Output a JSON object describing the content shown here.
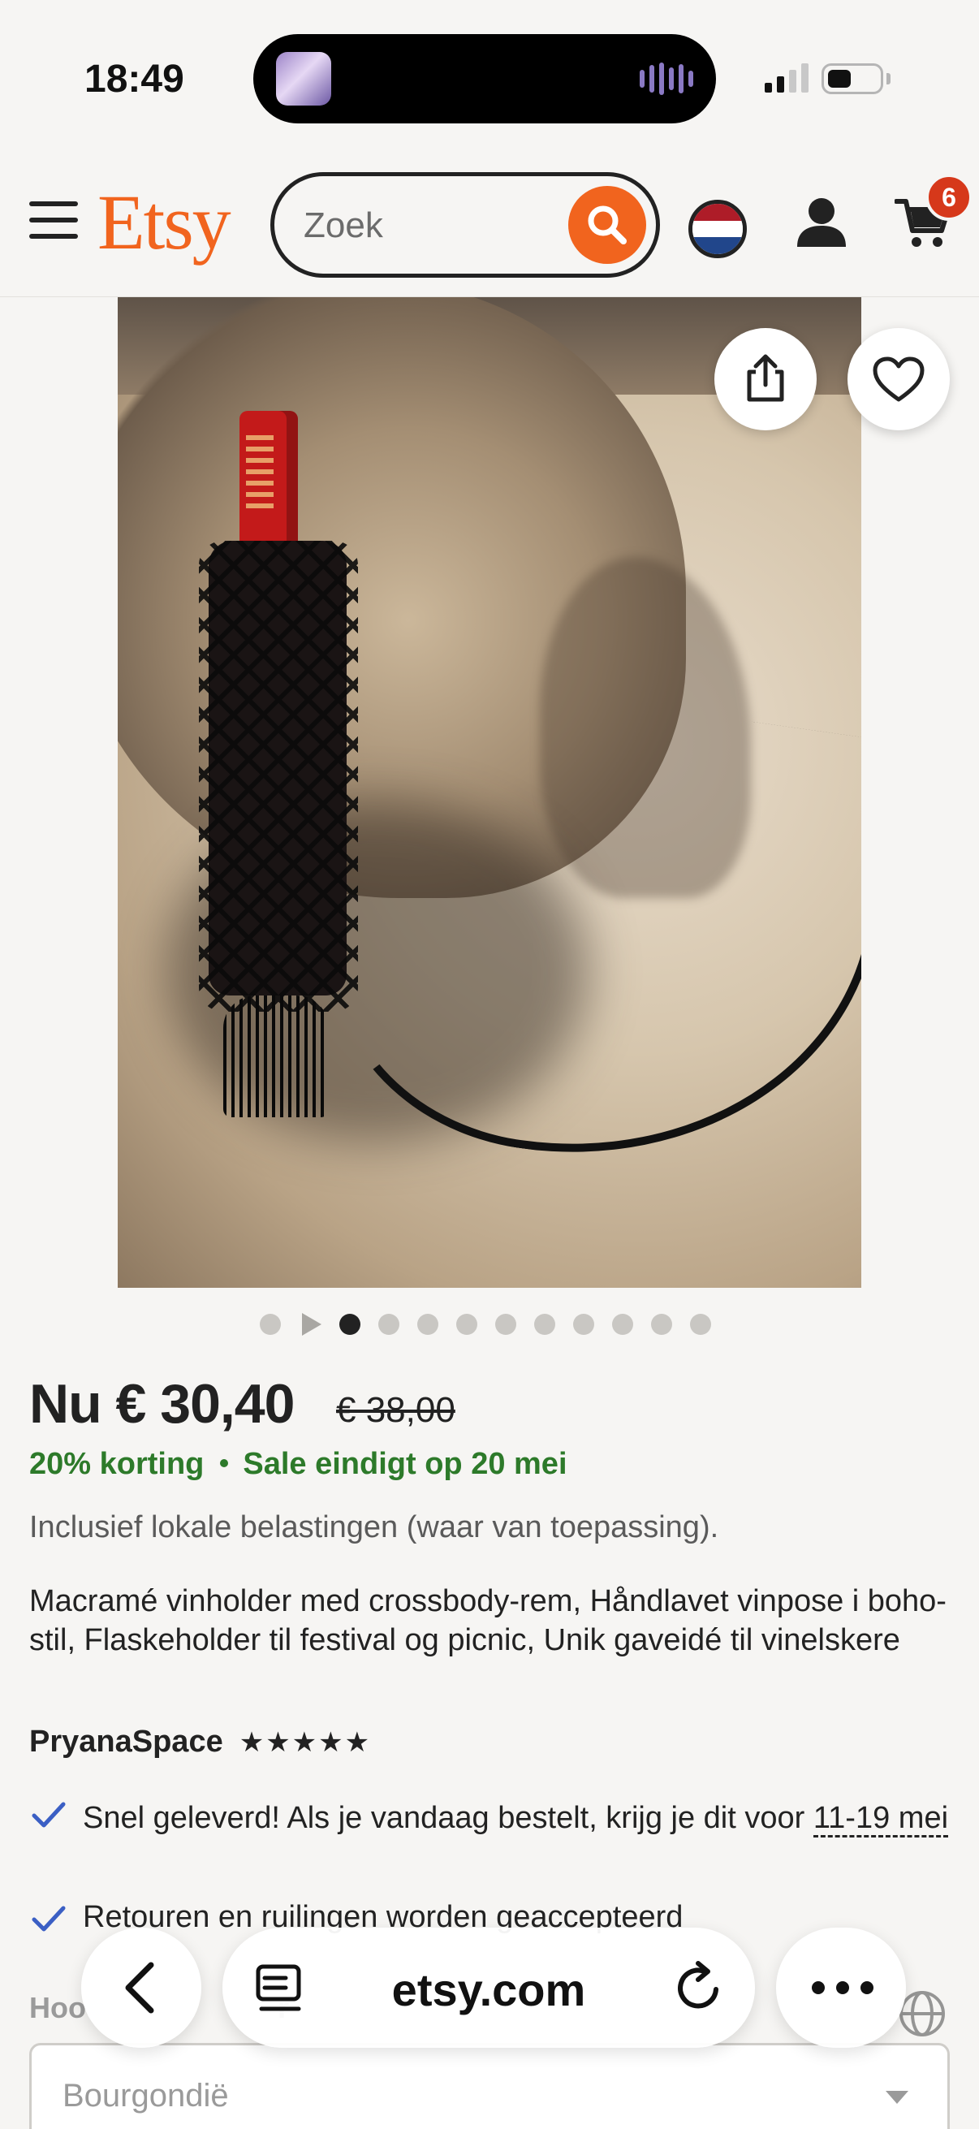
{
  "status_bar": {
    "time": "18:49"
  },
  "header": {
    "logo": "Etsy",
    "search": {
      "placeholder": "Zoek",
      "value": ""
    },
    "cart_count": "6",
    "icons": [
      "menu-icon",
      "search-icon",
      "flag-netherlands-icon",
      "account-icon",
      "cart-icon"
    ]
  },
  "colors": {
    "brand": "#f1641e",
    "sale_green": "#2d7a2a",
    "badge": "#d6381a"
  },
  "product": {
    "image_count": 11,
    "active_image": 1,
    "price": "Nu € 30,40",
    "old_price": "€ 38,00",
    "discount": "20% korting",
    "sale_end": "Sale eindigt op 20 mei",
    "tax_note": "Inclusief lokale belastingen (waar van toepassing).",
    "title": "Macramé vinholder med crossbody-rem, Håndlavet vinpose i boho-stil, Flaskeholder til festival og picnic, Unik gaveidé til vinelskere",
    "shop_name": "PryanaSpace",
    "rating_stars": "★★★★★",
    "perks": {
      "delivery_text": "Snel geleverd! Als je vandaag bestelt, krijg je dit voor ",
      "delivery_dates": "11-19 mei",
      "returns_text": "Retouren en ruilingen worden geaccepteerd"
    }
  },
  "destination": {
    "label": "Hoo",
    "label_tail": "r",
    "selected": "Bourgondië"
  },
  "browser_bar": {
    "domain": "etsy.com"
  }
}
